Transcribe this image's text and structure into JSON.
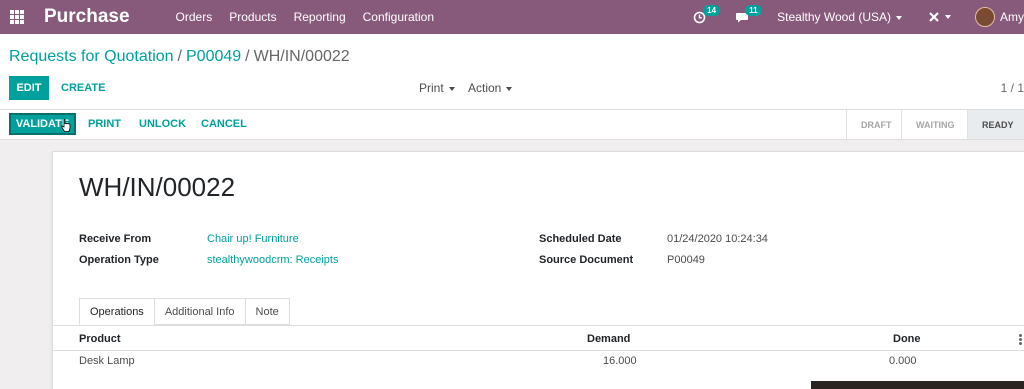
{
  "navbar": {
    "app_title": "Purchase",
    "menu": [
      "Orders",
      "Products",
      "Reporting",
      "Configuration"
    ],
    "activity_count": "14",
    "messages_count": "11",
    "company": "Stealthy Wood (USA)",
    "user": "Amy-"
  },
  "control_panel": {
    "breadcrumb": [
      "Requests for Quotation",
      "P00049",
      "WH/IN/00022"
    ],
    "edit_label": "EDIT",
    "create_label": "CREATE",
    "print_label": "Print",
    "action_label": "Action",
    "pager": "1 / 1"
  },
  "status_header": {
    "buttons": [
      "VALIDATE",
      "PRINT",
      "UNLOCK",
      "CANCEL"
    ],
    "stages": [
      "DRAFT",
      "WAITING",
      "READY"
    ],
    "active_stage": "READY"
  },
  "form": {
    "title": "WH/IN/00022",
    "receive_from_label": "Receive From",
    "receive_from_value": "Chair up! Furniture",
    "operation_type_label": "Operation Type",
    "operation_type_value": "stealthywoodcrm: Receipts",
    "scheduled_date_label": "Scheduled Date",
    "scheduled_date_value": "01/24/2020 10:24:34",
    "source_document_label": "Source Document",
    "source_document_value": "P00049",
    "tabs": [
      "Operations",
      "Additional Info",
      "Note"
    ],
    "columns": [
      "Product",
      "Demand",
      "Done"
    ],
    "rows": [
      {
        "product": "Desk Lamp",
        "demand": "16.000",
        "done": "0.000"
      }
    ]
  },
  "colors": {
    "navbar": "#875a7b",
    "accent": "#00a09d",
    "primary_button": "#00a09d"
  }
}
